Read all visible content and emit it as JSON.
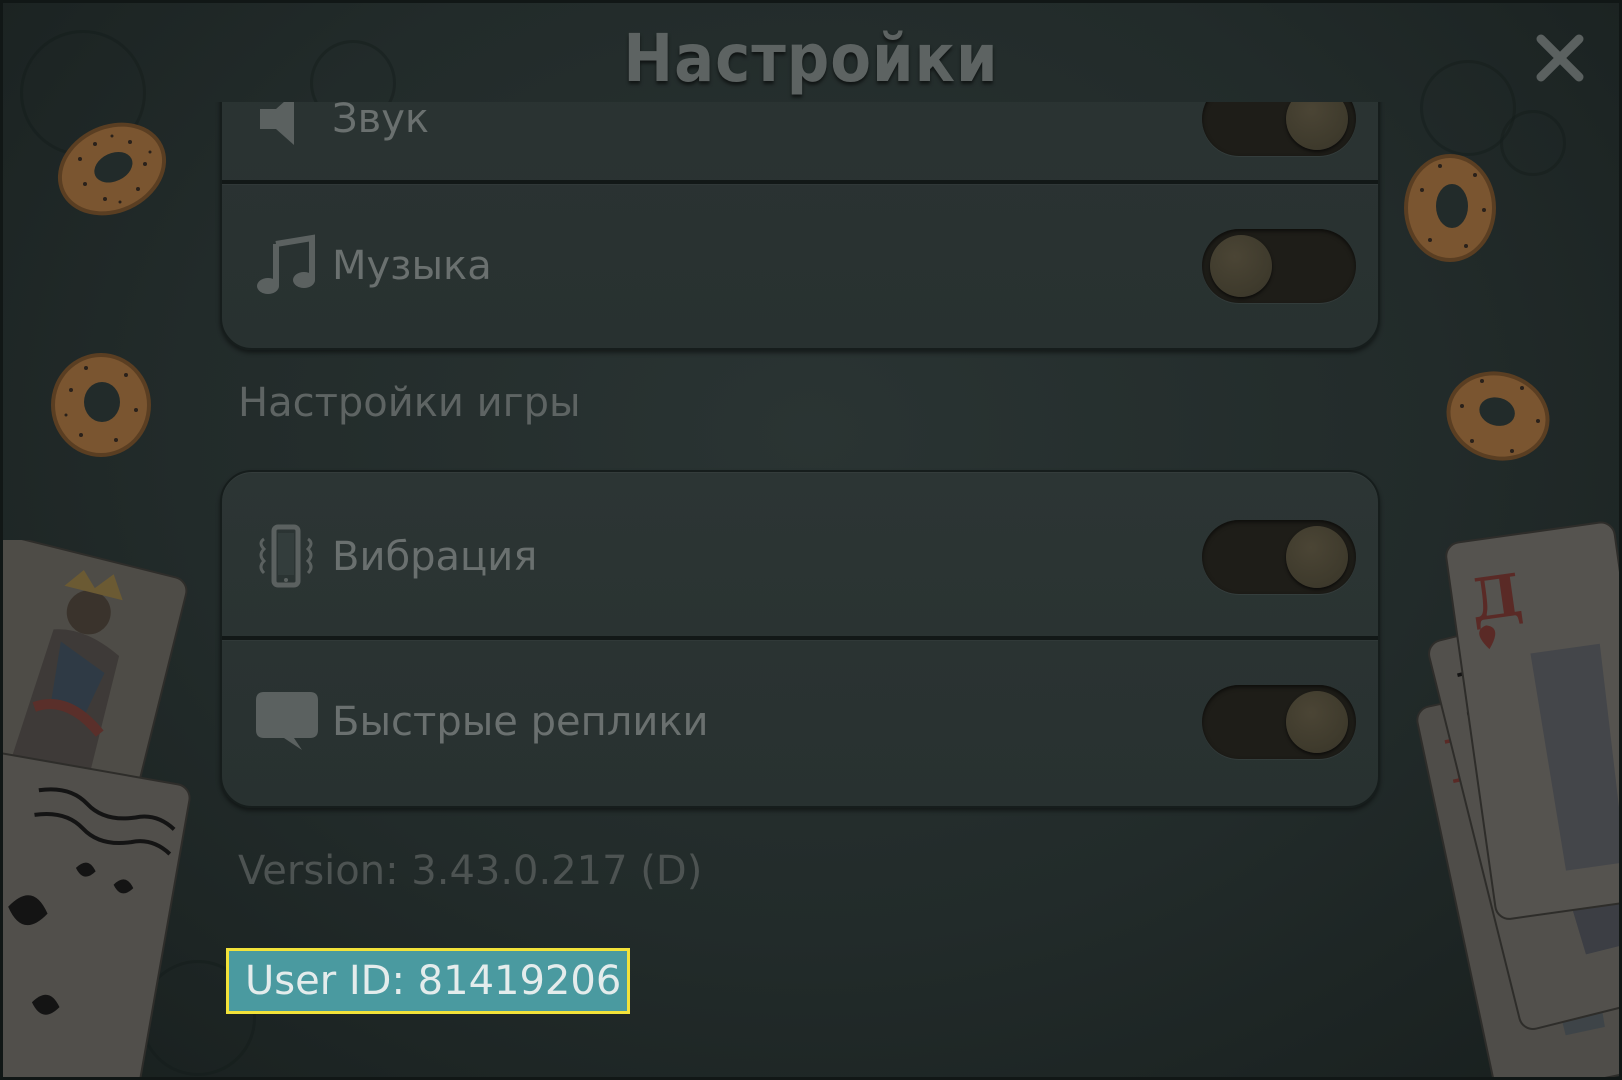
{
  "header": {
    "title": "Настройки"
  },
  "settings": {
    "sound_label": "Звук",
    "music_label": "Музыка",
    "game_section_title": "Настройки игры",
    "vibration_label": "Вибрация",
    "quick_replies_label": "Быстрые реплики",
    "sound_on": true,
    "music_on": false,
    "vibration_on": true,
    "quick_replies_on": true
  },
  "footer": {
    "version": "Version: 3.43.0.217 (D)",
    "user_id": "User ID: 81419206"
  },
  "icons": {
    "close": "close-icon",
    "sound": "speaker-icon",
    "music": "music-note-icon",
    "vibration": "phone-vibration-icon",
    "quick_replies": "speech-bubble-icon"
  },
  "colors": {
    "background": "#222b2a",
    "title": "#5d6362",
    "label": "#6a706f",
    "toggle_track": "#1e1d18",
    "toggle_knob": "#3e3a2c",
    "user_id_highlight": "#4a9aa0",
    "user_id_border": "#f2e23a"
  }
}
